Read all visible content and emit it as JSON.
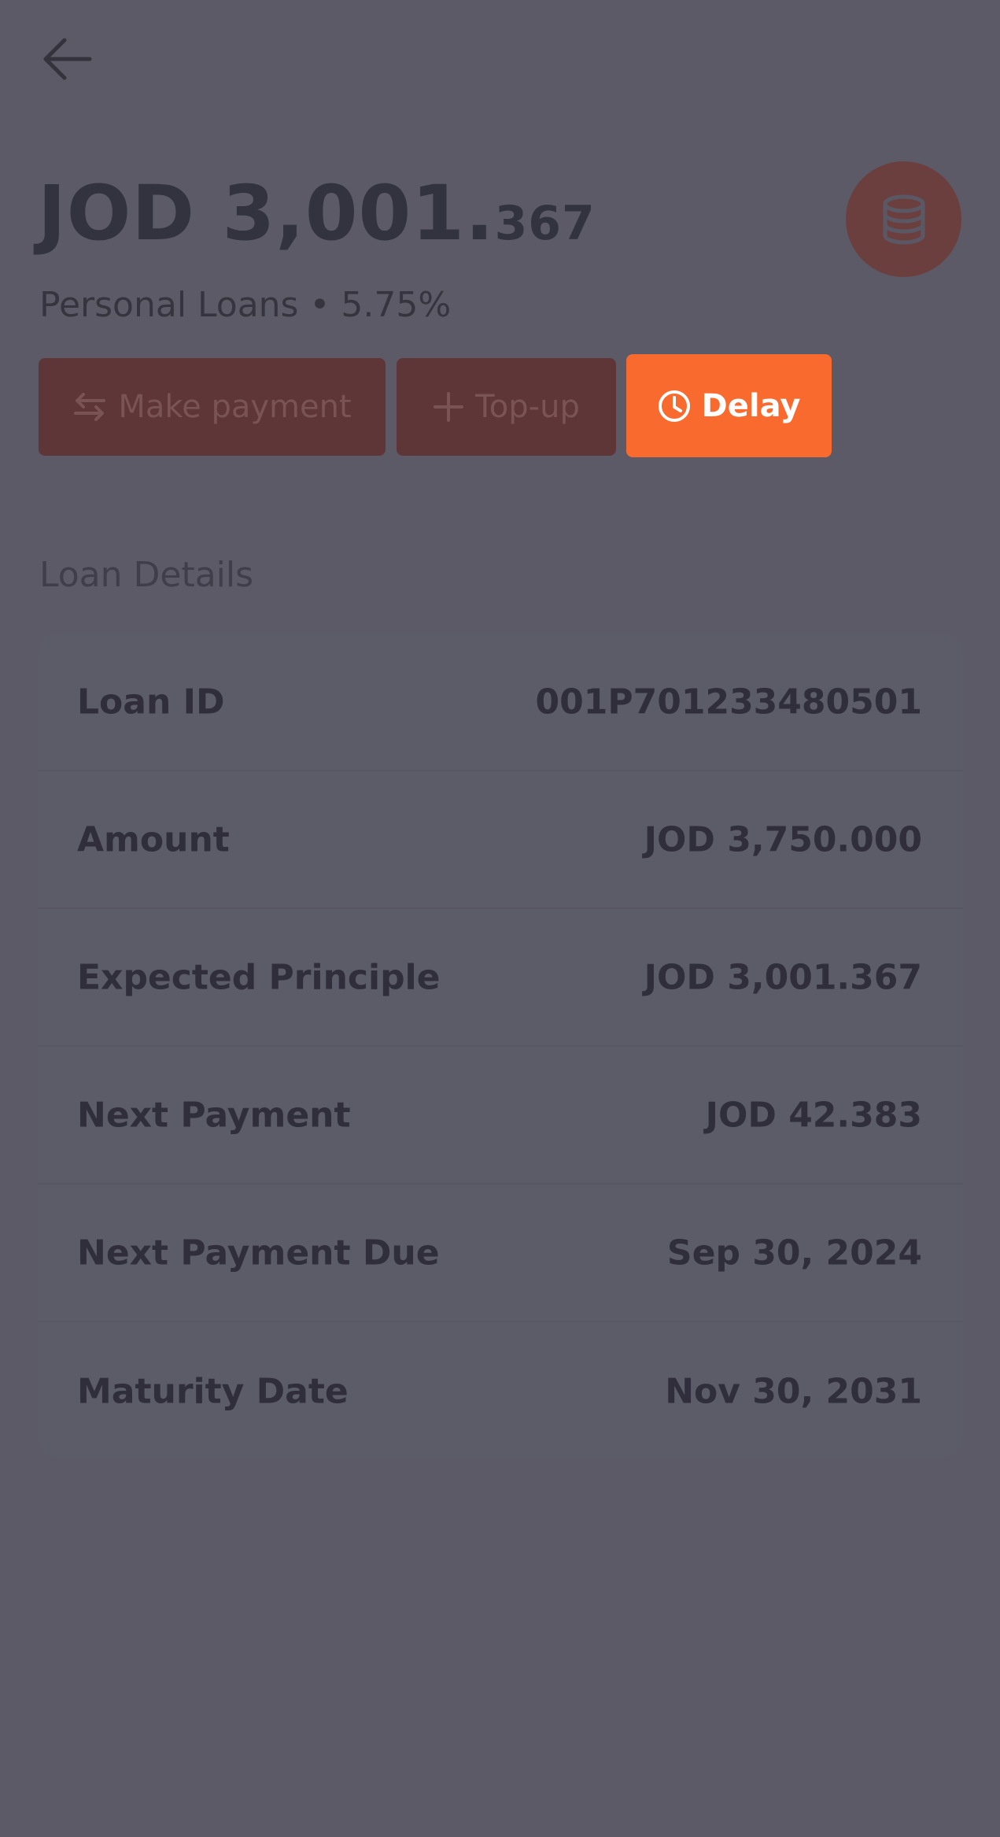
{
  "header": {
    "back_icon": "arrow-left-icon",
    "amount_main": "JOD 3,001.",
    "amount_decimals": "367",
    "subtitle": "Personal Loans • 5.75%",
    "badge_icon": "coins-stack-icon"
  },
  "actions": {
    "make_payment": {
      "label": "Make payment",
      "icon": "transfer-arrows-icon"
    },
    "top_up": {
      "label": "Top-up",
      "icon": "plus-icon"
    },
    "delay": {
      "label": "Delay",
      "icon": "clock-icon"
    }
  },
  "details": {
    "title": "Loan Details",
    "rows": [
      {
        "label": "Loan ID",
        "value": "001P701233480501"
      },
      {
        "label": "Amount",
        "value": "JOD 3,750.000"
      },
      {
        "label": "Expected Principle",
        "value": "JOD 3,001.367"
      },
      {
        "label": "Next Payment",
        "value": "JOD 42.383"
      },
      {
        "label": "Next Payment Due",
        "value": "Sep 30, 2024"
      },
      {
        "label": "Maturity Date",
        "value": "Nov 30, 2031"
      }
    ]
  },
  "colors": {
    "background": "#5b5a66",
    "accent": "#f96a2e",
    "muted_button": "#5e3638",
    "text_dark": "#2f2e3a"
  }
}
